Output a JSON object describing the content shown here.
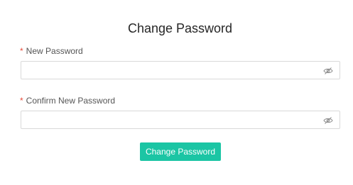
{
  "form": {
    "title": "Change Password",
    "new_password": {
      "required_mark": "*",
      "label": "New Password",
      "value": "",
      "icon": "eye-slash-icon"
    },
    "confirm_password": {
      "required_mark": "*",
      "label": "Confirm New Password",
      "value": "",
      "icon": "eye-slash-icon"
    },
    "submit_label": "Change Password"
  },
  "colors": {
    "accent": "#1bc5a4",
    "required": "#e74c3c",
    "border": "#d9d9d9"
  }
}
